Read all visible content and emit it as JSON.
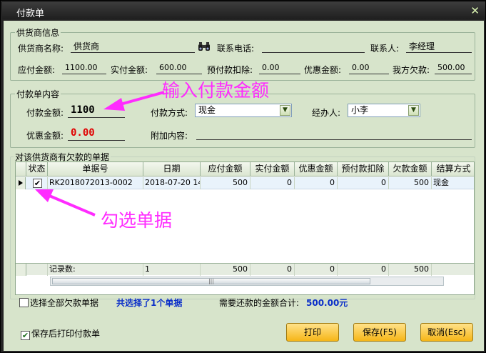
{
  "window": {
    "title": "付款单",
    "close_glyph": "✕"
  },
  "supplier_group": {
    "legend": "供货商信息",
    "name_label": "供货商名称:",
    "name_value": "供货商",
    "phone_label": "联系电话:",
    "phone_value": "",
    "contact_label": "联系人:",
    "contact_value": "李经理",
    "payable_label": "应付金额:",
    "payable_value": "1100.00",
    "paid_label": "实付金额:",
    "paid_value": "600.00",
    "prepay_label": "预付款扣除:",
    "prepay_value": "0.00",
    "discount_label": "优惠金额:",
    "discount_value": "0.00",
    "owed_label": "我方欠款:",
    "owed_value": "500.00"
  },
  "payment_group": {
    "legend": "付款单内容",
    "amount_label": "付款金额:",
    "amount_value": "1100",
    "method_label": "付款方式:",
    "method_value": "现金",
    "handler_label": "经办人:",
    "handler_value": "小李",
    "discount_label": "优惠金额:",
    "discount_value": "0.00",
    "extra_label": "附加内容:",
    "extra_value": ""
  },
  "bills_group": {
    "legend": "对该供货商有欠款的单据",
    "columns": [
      "状态",
      "单据号",
      "日期",
      "应付金额",
      "实付金额",
      "优惠金额",
      "预付款扣除",
      "欠款金额",
      "结算方式"
    ],
    "rows": [
      {
        "checked": "✔",
        "bill_no": "RK2018072013-0002",
        "date": "2018-07-20 14",
        "payable": "500",
        "paid": "0",
        "discount": "0",
        "prepay": "0",
        "owed": "500",
        "method": "现金"
      }
    ],
    "footer": {
      "count_label": "记录数:",
      "count": "1",
      "payable": "500",
      "paid": "0",
      "discount": "0",
      "prepay": "0",
      "owed": "500"
    },
    "scroll_glyph": "|||"
  },
  "bottom": {
    "select_all_label": "选择全部欠款单据",
    "selected_text": "共选择了1个单据",
    "total_label": "需要还款的金额合计:",
    "total_value": "500.00元",
    "print_after_save_label": "保存后打印付款单",
    "print_after_save_checked": "✔",
    "print_button": "打印",
    "save_button": "保存(F5)",
    "cancel_button": "取消(Esc)"
  },
  "annotations": {
    "enter_amount": "输入付款金额",
    "tick_bill": "勾选单据"
  },
  "colors": {
    "client_bg": "#d7e4cb",
    "button": "#f6b618",
    "annotation": "#ff2bff",
    "discount_red": "#e00000",
    "total_blue": "#0a2ec9"
  }
}
